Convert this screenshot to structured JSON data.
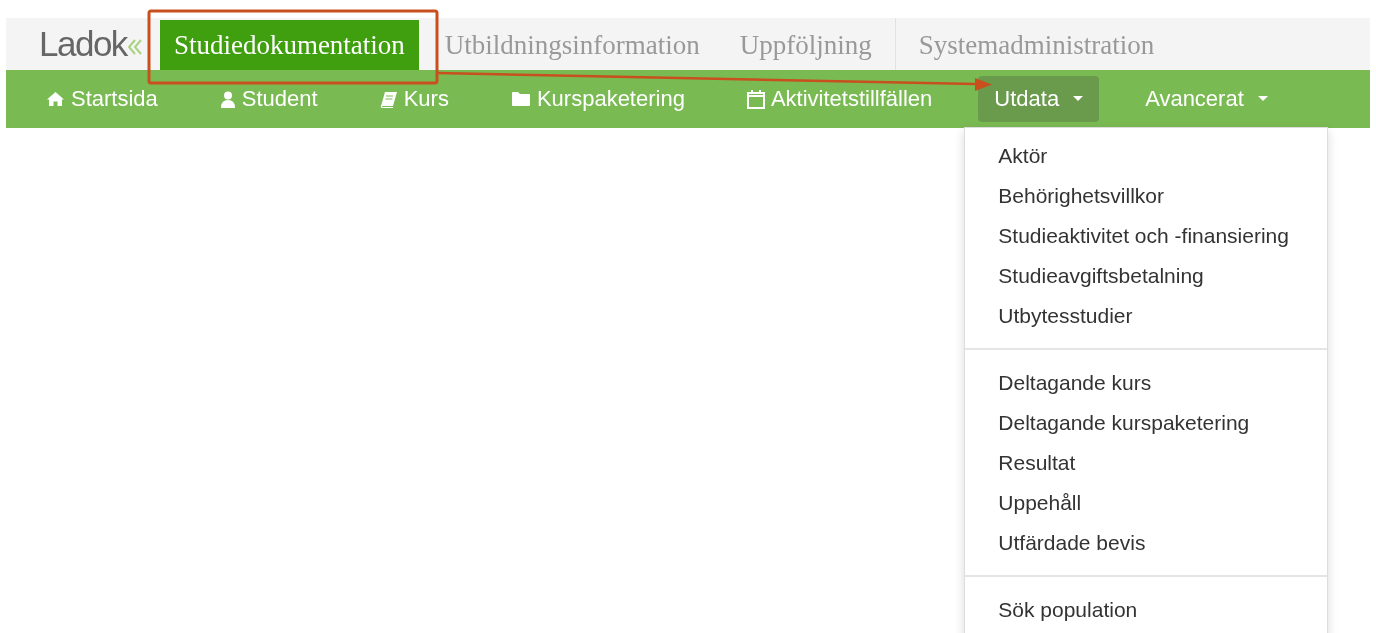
{
  "logo": "Ladok",
  "modules": [
    {
      "label": "Studiedokumentation",
      "selected": true
    },
    {
      "label": "Utbildningsinformation",
      "selected": false
    },
    {
      "label": "Uppföljning",
      "selected": false
    },
    {
      "label": "Systemadministration",
      "selected": false
    }
  ],
  "nav": [
    {
      "label": "Startsida",
      "kind": "home",
      "selected": false
    },
    {
      "label": "Student",
      "kind": "user",
      "selected": false
    },
    {
      "label": "Kurs",
      "kind": "book",
      "selected": false
    },
    {
      "label": "Kurspaketering",
      "kind": "folder",
      "selected": false
    },
    {
      "label": "Aktivitetstillfällen",
      "kind": "calendar",
      "selected": false
    },
    {
      "label": "Utdata",
      "kind": "dropdown",
      "selected": true
    },
    {
      "label": "Avancerat",
      "kind": "dropdown",
      "selected": false
    }
  ],
  "menu": {
    "groups": [
      [
        "Aktör",
        "Behörighetsvillkor",
        "Studieaktivitet och -finansiering",
        "Studieavgiftsbetalning",
        "Utbytesstudier"
      ],
      [
        "Deltagande kurs",
        "Deltagande kurspaketering",
        "Resultat",
        "Uppehåll",
        "Utfärdade bevis"
      ],
      [
        "Sök population"
      ]
    ]
  }
}
